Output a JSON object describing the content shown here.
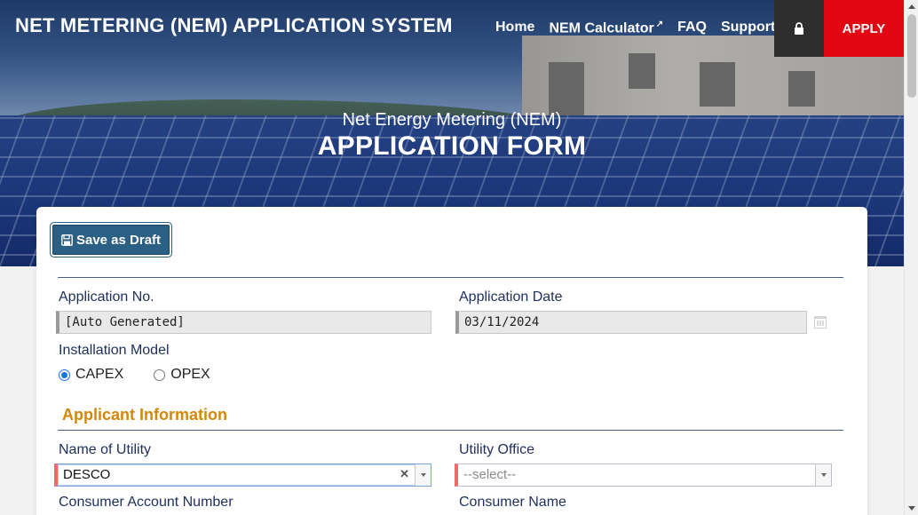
{
  "nav": {
    "brand": "NET METERING (NEM) APPLICATION SYSTEM",
    "links": [
      "Home",
      "NEM Calculator",
      "FAQ",
      "Support"
    ],
    "apply_label": "APPLY"
  },
  "hero": {
    "subtitle": "Net Energy Metering (NEM)",
    "title": "APPLICATION FORM"
  },
  "toolbar": {
    "draft_label": "Save as Draft"
  },
  "form": {
    "application_no_label": "Application No.",
    "application_no_value": "[Auto Generated]",
    "application_date_label": "Application Date",
    "application_date_value": "03/11/2024",
    "installation_model_label": "Installation Model",
    "installation_options": [
      "CAPEX",
      "OPEX"
    ],
    "installation_selected": "CAPEX",
    "section_title": "Applicant Information",
    "utility_label": "Name of Utility",
    "utility_value": "DESCO",
    "utility_office_label": "Utility Office",
    "utility_office_placeholder": "--select--",
    "consumer_account_label": "Consumer Account Number",
    "consumer_name_label": "Consumer Name"
  },
  "colors": {
    "apply_bg": "#e20613",
    "draft_bg": "#2b5f83",
    "section_title": "#d4870a",
    "label": "#1e2f5c"
  }
}
